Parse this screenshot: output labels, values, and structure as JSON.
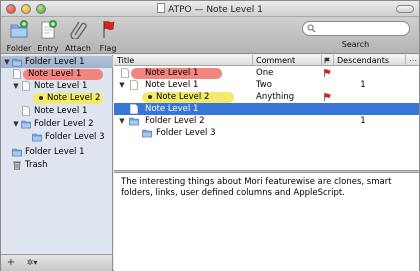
{
  "window": {
    "title": "ATPO — Note Level 1"
  },
  "toolbar": {
    "items": [
      {
        "label": "Folder",
        "icon": "folder-add-icon"
      },
      {
        "label": "Entry",
        "icon": "entry-add-icon"
      },
      {
        "label": "Attach",
        "icon": "paperclip-icon"
      },
      {
        "label": "Flag",
        "icon": "flag-icon"
      }
    ],
    "search": {
      "label": "Search",
      "value": "",
      "placeholder": ""
    }
  },
  "sidebar": {
    "items": [
      {
        "label": "Folder Level 1",
        "icon": "folder-icon",
        "depth": 0,
        "disclosure": "open",
        "selected": true
      },
      {
        "label": "Note Level 1",
        "icon": "note-icon",
        "depth": 1,
        "disclosure": "none",
        "highlight": "red"
      },
      {
        "label": "Note Level 1",
        "icon": "note-icon",
        "depth": 1,
        "disclosure": "open"
      },
      {
        "label": "Note Level 2",
        "icon": "bullet-icon",
        "depth": 2,
        "disclosure": "none",
        "highlight": "yellow"
      },
      {
        "label": "Note Level 1",
        "icon": "note-icon",
        "depth": 1,
        "disclosure": "none"
      },
      {
        "label": "Folder Level 2",
        "icon": "folder-icon",
        "depth": 1,
        "disclosure": "open"
      },
      {
        "label": "Folder Level 3",
        "icon": "folder-icon",
        "depth": 2,
        "disclosure": "none"
      },
      {
        "label": "Folder Level 1",
        "icon": "folder-icon",
        "depth": 0,
        "disclosure": "none"
      },
      {
        "label": "Trash",
        "icon": "trash-icon",
        "depth": 0,
        "disclosure": "none"
      }
    ]
  },
  "bottombar": {
    "add": "+",
    "action": "✲▾"
  },
  "outline": {
    "columns": [
      "Title",
      "Comment",
      "",
      "Descendants"
    ],
    "rows": [
      {
        "title": "Note Level 1",
        "comment": "One",
        "flag": true,
        "descendants": "",
        "highlight": "red",
        "depth": 0,
        "icon": "note-icon",
        "disclosure": "none"
      },
      {
        "title": "Note Level 1",
        "comment": "Two",
        "flag": false,
        "descendants": "1",
        "depth": 0,
        "icon": "note-icon",
        "disclosure": "open"
      },
      {
        "title": "Note Level 2",
        "comment": "Anything",
        "flag": true,
        "descendants": "",
        "highlight": "yellow",
        "depth": 1,
        "icon": "bullet-icon",
        "disclosure": "none"
      },
      {
        "title": "Note Level 1",
        "comment": "",
        "flag": false,
        "descendants": "",
        "depth": 0,
        "icon": "note-icon",
        "disclosure": "none",
        "selected": true
      },
      {
        "title": "Folder Level 2",
        "comment": "",
        "flag": false,
        "descendants": "1",
        "depth": 0,
        "icon": "folder-icon",
        "disclosure": "open"
      },
      {
        "title": "Folder Level 3",
        "comment": "",
        "flag": false,
        "descendants": "",
        "depth": 1,
        "icon": "folder-icon",
        "disclosure": "none"
      }
    ]
  },
  "note": {
    "text": "The interesting things about Mori featurewise are clones, smart folders, links, user defined columns and AppleScript."
  },
  "colors": {
    "selection": "#3875d7",
    "sidebar_bg": "#dfe5ee",
    "highlight_red": "#f2867f",
    "highlight_yellow": "#f2ea6a",
    "flag_red": "#d8241c"
  }
}
